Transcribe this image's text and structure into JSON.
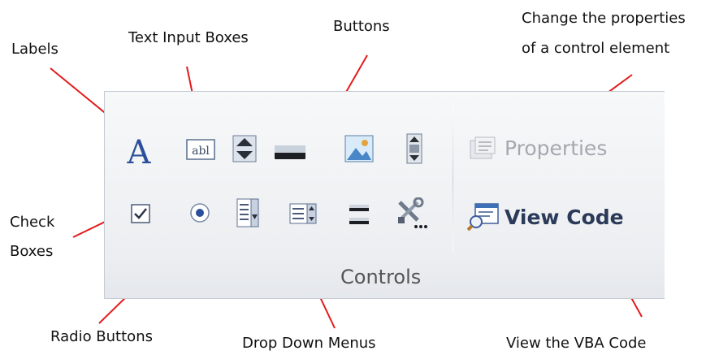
{
  "annotations": {
    "labels": "Labels",
    "text_input_boxes": "Text Input Boxes",
    "buttons": "Buttons",
    "change_properties_line1": "Change the properties",
    "change_properties_line2": "of a control element",
    "check_boxes_line1": "Check",
    "check_boxes_line2": "Boxes",
    "radio_buttons": "Radio Buttons",
    "drop_down_menus": "Drop Down Menus",
    "view_vba_code": "View the VBA Code"
  },
  "ribbon": {
    "group_label": "Controls",
    "row1": [
      {
        "id": "label",
        "icon": "label-a-icon"
      },
      {
        "id": "textbox",
        "icon": "textbox-icon"
      },
      {
        "id": "spin",
        "icon": "spin-button-icon"
      },
      {
        "id": "button",
        "icon": "command-button-icon"
      },
      {
        "id": "image",
        "icon": "image-icon"
      },
      {
        "id": "scrollbar",
        "icon": "scrollbar-icon"
      }
    ],
    "row2": [
      {
        "id": "checkbox",
        "icon": "checkbox-icon"
      },
      {
        "id": "radio",
        "icon": "radio-button-icon"
      },
      {
        "id": "combobox",
        "icon": "combo-box-icon"
      },
      {
        "id": "listbox",
        "icon": "list-box-icon"
      },
      {
        "id": "toggle",
        "icon": "toggle-button-icon"
      },
      {
        "id": "more",
        "icon": "more-controls-icon"
      }
    ],
    "properties_label": "Properties",
    "view_code_label": "View Code"
  },
  "colors": {
    "arrow": "#e31b1b",
    "panel_border": "#c5cbd3",
    "icon_blue": "#2b4f9a",
    "disabled_text": "#a4a9b0",
    "view_code_text": "#2a3a58"
  }
}
